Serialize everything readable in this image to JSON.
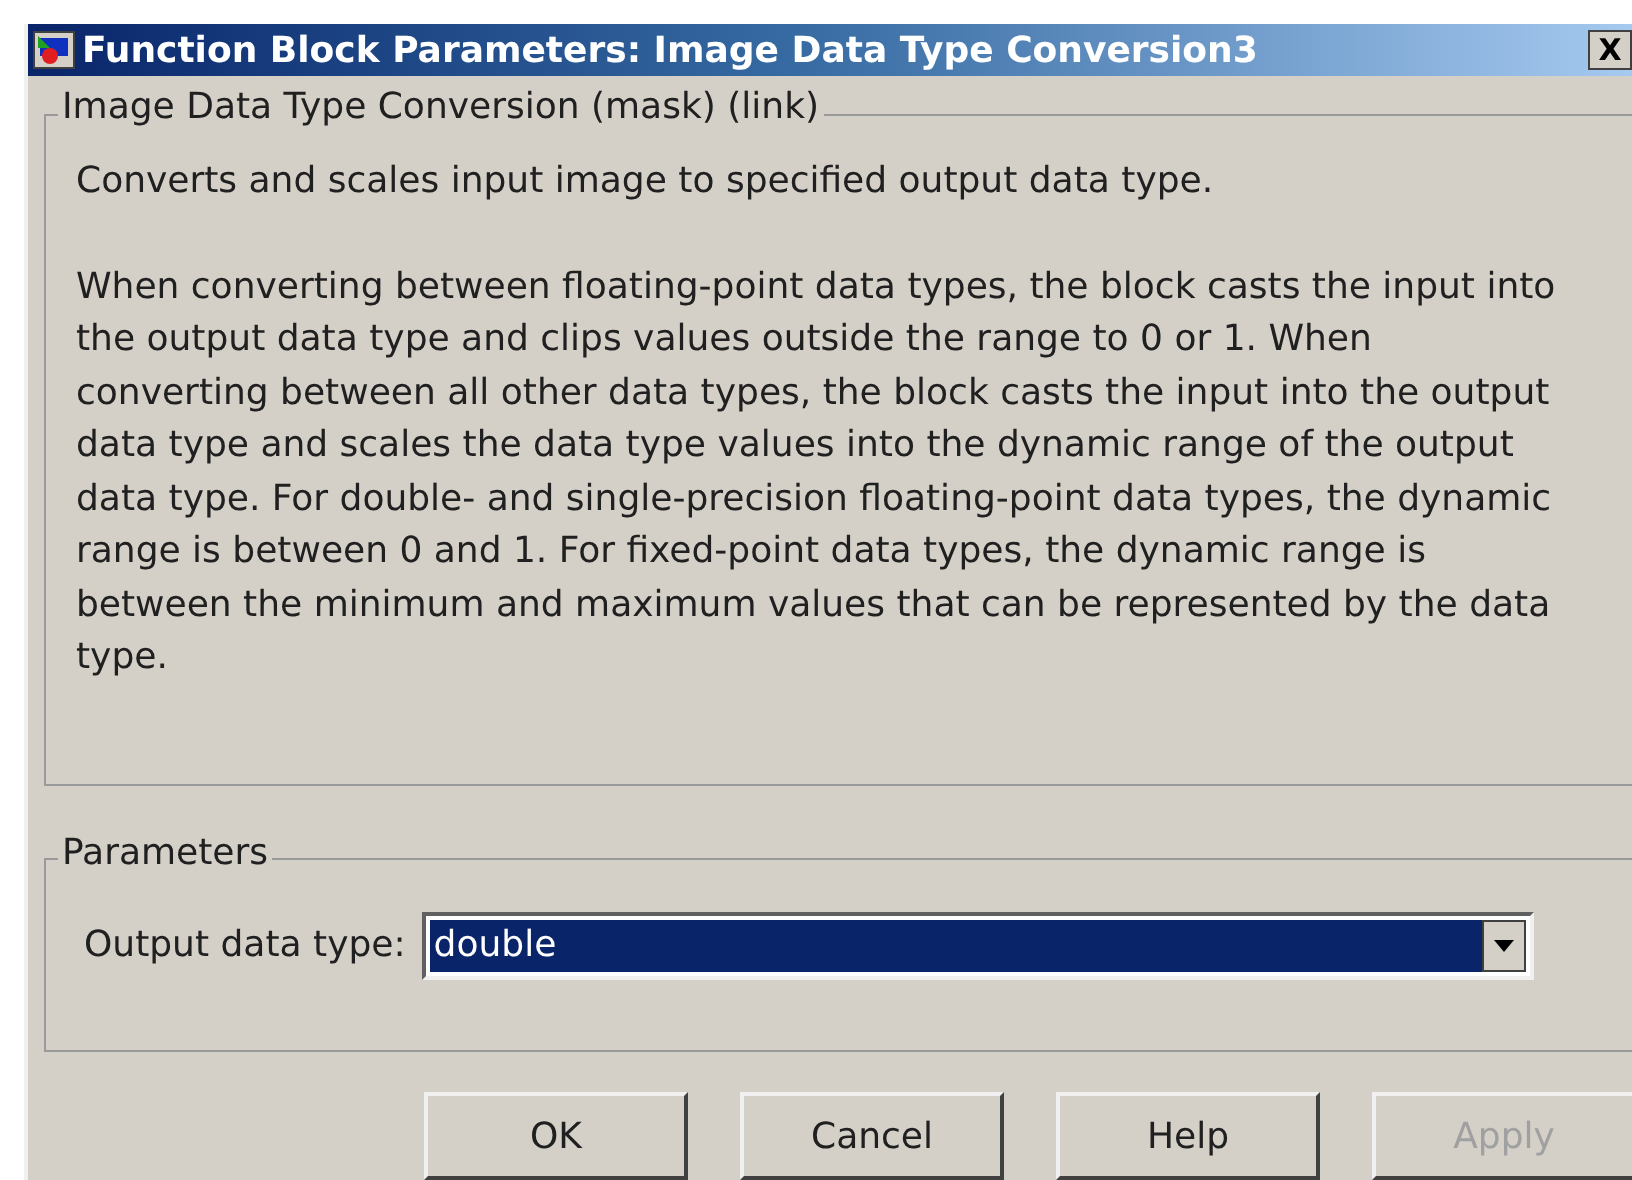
{
  "window": {
    "title": "Function Block Parameters: Image Data Type Conversion3",
    "close": "X"
  },
  "description": {
    "legend": "Image Data Type Conversion (mask) (link)",
    "paragraphs": [
      "Converts and scales input image to specified output data type.",
      "When converting between floating-point data types, the block casts the input into the output data type and clips values outside the range to 0 or 1. When converting between all other data types, the block casts the input into the output data type and scales the data type values into the dynamic range of the output data type. For double- and single-precision floating-point data types, the dynamic range is between 0 and 1. For fixed-point data types, the dynamic range is between the minimum and maximum values that can be represented by the data type."
    ]
  },
  "parameters": {
    "legend": "Parameters",
    "fields": [
      {
        "label": "Output data type:",
        "value": "double"
      }
    ]
  },
  "buttons": [
    {
      "label": "OK",
      "disabled": false
    },
    {
      "label": "Cancel",
      "disabled": false
    },
    {
      "label": "Help",
      "disabled": false
    },
    {
      "label": "Apply",
      "disabled": true
    }
  ]
}
